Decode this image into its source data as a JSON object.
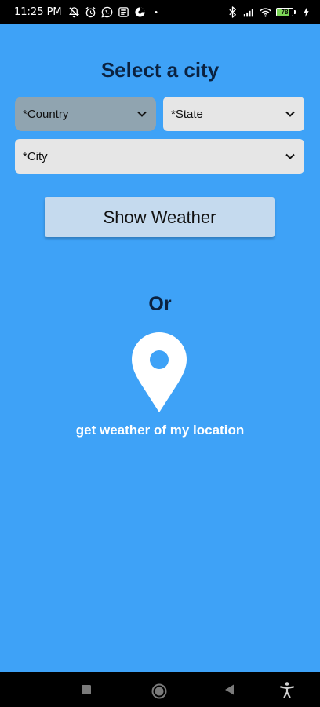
{
  "status_bar": {
    "time": "11:25 PM",
    "battery_level": "78",
    "battery_fraction": 0.78,
    "left_icons": [
      "muted-notifications-icon",
      "alarm-icon",
      "whatsapp-icon",
      "news-icon",
      "app-circle-icon",
      "dot-icon"
    ],
    "right_icons": [
      "bluetooth-icon",
      "signal-icon",
      "wifi-icon",
      "battery-icon",
      "charging-icon"
    ]
  },
  "page": {
    "title": "Select a city",
    "country_placeholder": "*Country",
    "state_placeholder": "*State",
    "city_placeholder": "*City",
    "show_weather_label": "Show Weather",
    "or_label": "Or",
    "location_label": "get weather of my location",
    "location_icon": "location-pin-icon"
  },
  "nav_bar": {
    "buttons": [
      "recents-icon",
      "home-icon",
      "back-icon",
      "accessibility-icon"
    ]
  },
  "colors": {
    "background": "#3ea2f7",
    "title_text": "#0b2240",
    "dropdown_bg": "#e6e6e6",
    "dropdown_selected_bg": "#90a4b0",
    "button_bg": "#c5daee",
    "battery_fill": "#7cd657"
  }
}
